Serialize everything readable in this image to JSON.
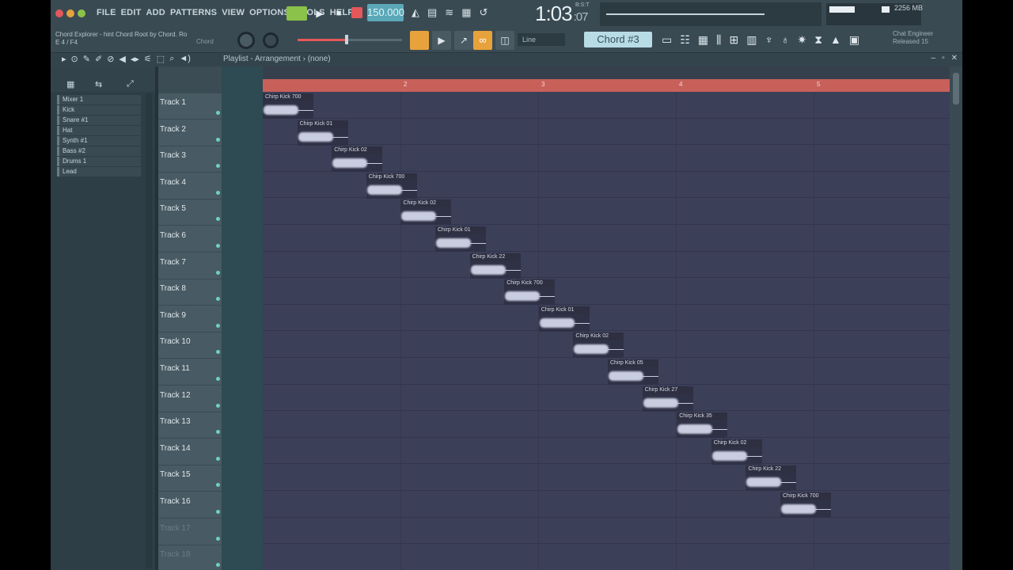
{
  "menu": [
    "FILE",
    "EDIT",
    "ADD",
    "PATTERNS",
    "VIEW",
    "OPTIONS",
    "TOOLS",
    "HELP"
  ],
  "transport": {
    "tempo": "150.000",
    "time_main": "1:03",
    "time_sub": ":07",
    "time_sig": "B:S:T"
  },
  "hint": {
    "line1": "Chord Explorer - hint Chord Root by Chord. Ro",
    "line2": "E 4 / F4",
    "right": "Chord"
  },
  "snap": "Line",
  "chord_label": "Chord #3",
  "project_info": {
    "line1": "Chat Engineer",
    "line2": "Released 15"
  },
  "cpu": "2256 MB",
  "playlist": {
    "title": "Playlist - Arrangement › (none)"
  },
  "browser_items": [
    "Mixer 1",
    "Kick",
    "Snare #1",
    "Hat",
    "Synth #1",
    "Bass #2",
    "Drums 1",
    "Lead"
  ],
  "tracks": [
    "Track 1",
    "Track 2",
    "Track 3",
    "Track 4",
    "Track 5",
    "Track 6",
    "Track 7",
    "Track 8",
    "Track 9",
    "Track 10",
    "Track 11",
    "Track 12",
    "Track 13",
    "Track 14",
    "Track 15",
    "Track 16",
    "Track 17",
    "Track 18"
  ],
  "ruler_marks": [
    "2",
    "3",
    "4",
    "5"
  ],
  "clips": [
    "Chirp Kick 700",
    "Chirp Kick 01",
    "Chirp Kick 02",
    "Chirp Kick 700",
    "Chirp Kick 02",
    "Chirp Kick 01",
    "Chirp Kick 22",
    "Chirp Kick 700",
    "Chirp Kick 01",
    "Chirp Kick 02",
    "Chirp Kick 05",
    "Chirp Kick 27",
    "Chirp Kick 35",
    "Chirp Kick 02",
    "Chirp Kick 22",
    "Chirp Kick 700"
  ],
  "colors": {
    "ruler": "#c8605a",
    "tempo": "#5aa8b8",
    "accent_orange": "#e8a23c",
    "pattern_green": "#8bc24a"
  }
}
